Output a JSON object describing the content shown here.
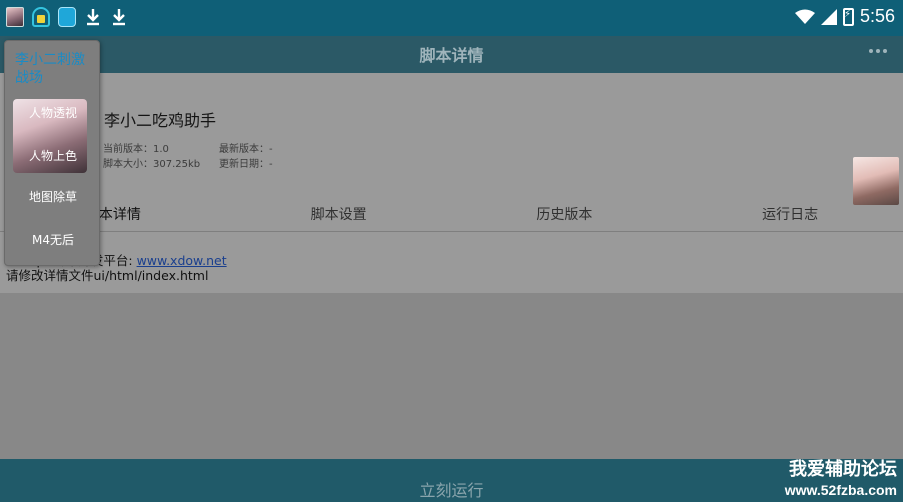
{
  "statusbar": {
    "time": "5:56",
    "icons": [
      "avatar-icon",
      "lock-icon",
      "app-icon",
      "download-icon",
      "download-icon",
      "wifi-icon",
      "signal-icon",
      "battery-icon"
    ]
  },
  "appbar": {
    "title": "脚本详情",
    "more_icon": "more-icon"
  },
  "script": {
    "name": "李小二吃鸡助手",
    "current_version_label": "当前版本：",
    "current_version": "1.0",
    "latest_version_label": "最新版本：",
    "latest_version": "-",
    "size_label": "脚本大小：",
    "size": "307.25kb",
    "update_date_label": "更新日期：",
    "update_date": "-"
  },
  "tabs": [
    "脚本详情",
    "脚本设置",
    "历史版本",
    "运行日志"
  ],
  "body": {
    "platform_label": "Xscript 脚本开发平台: ",
    "platform_link": "www.xdow.net",
    "hint": "请修改详情文件ui/html/index.html"
  },
  "floating_menu": {
    "title": "李小二刺激战场",
    "items": [
      "人物透视",
      "人物上色",
      "地图除草",
      "M4无后"
    ]
  },
  "bottombar": {
    "run_label": "立刻运行"
  },
  "watermark": {
    "line1": "我爱辅助论坛",
    "line2": "www.52fzba.com"
  }
}
